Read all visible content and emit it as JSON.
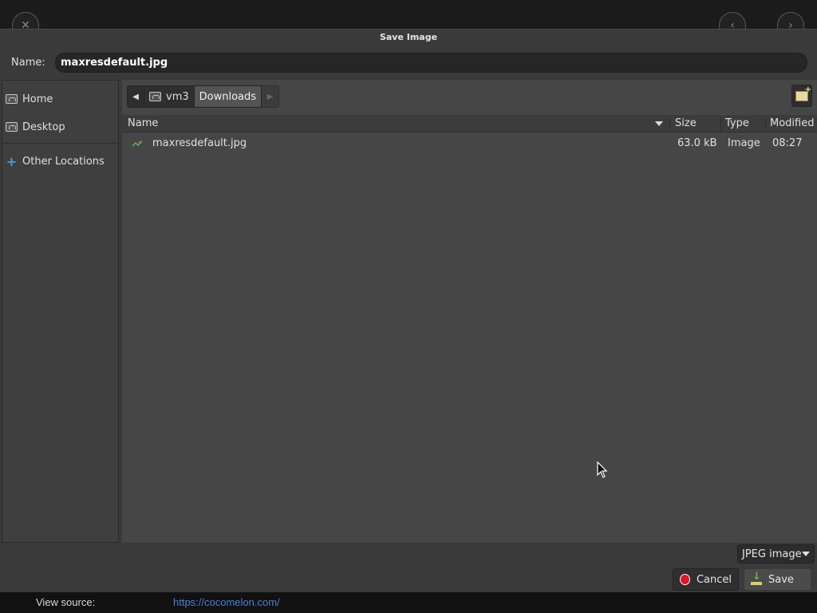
{
  "dialog": {
    "title": "Save Image"
  },
  "name_field": {
    "label": "Name:",
    "value": "maxresdefault.jpg"
  },
  "sidebar": {
    "items": [
      {
        "label": "Home",
        "icon": "home-folder-icon"
      },
      {
        "label": "Desktop",
        "icon": "desktop-folder-icon"
      },
      {
        "label": "Other Locations",
        "icon": "plus-icon"
      }
    ]
  },
  "pathbar": {
    "segments": [
      {
        "label": "vm3",
        "icon": "home-folder-icon"
      },
      {
        "label": "Downloads"
      }
    ]
  },
  "file_list": {
    "columns": {
      "name": "Name",
      "size": "Size",
      "type": "Type",
      "modified": "Modified"
    },
    "rows": [
      {
        "name": "maxresdefault.jpg",
        "size": "63.0 kB",
        "type": "Image",
        "modified": "08:27"
      }
    ]
  },
  "filter": {
    "selected": "JPEG image"
  },
  "buttons": {
    "cancel": "Cancel",
    "save": "Save"
  },
  "statusbar": {
    "label": "View source:",
    "url": "https://cocomelon.com/"
  },
  "colors": {
    "link": "#4a7fd6",
    "cancel_icon": "#e0162b",
    "background": "#3a3a3a"
  }
}
